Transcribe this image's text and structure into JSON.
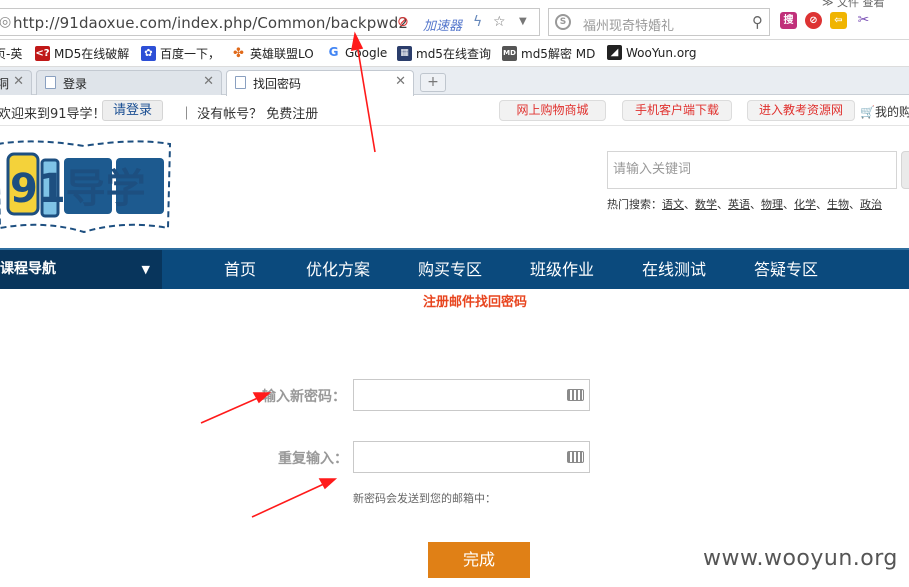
{
  "browser": {
    "url": "http://91daoxue.com/index.php/Common/backpwd2",
    "accelerator": "加速器",
    "search_placeholder": "福州现奇特婚礼",
    "top_menu": "≫   文件   查看"
  },
  "bookmarks": [
    {
      "label": "页-英"
    },
    {
      "label": "MD5在线破解"
    },
    {
      "label": "百度一下，"
    },
    {
      "label": "英雄联盟LO"
    },
    {
      "label": "Google"
    },
    {
      "label": "md5在线查询"
    },
    {
      "label": "md5解密 MD"
    },
    {
      "label": "WooYun.org"
    }
  ],
  "tabs": [
    {
      "label": "洞"
    },
    {
      "label": "登录"
    },
    {
      "label": "找回密码"
    }
  ],
  "site": {
    "welcome": "欢迎来到91导学！",
    "login_button": "请登录",
    "register_prefix": "｜ 没有帐号？",
    "register_link": "免费注册",
    "pills": [
      "网上购物商城",
      "手机客户端下载",
      "进入教考资源网"
    ],
    "cart": "我的购",
    "logo_text": "91导学",
    "search_placeholder": "请输入关键词",
    "hot_label": "热门搜索：",
    "hot_keywords": [
      "语文",
      "数学",
      "英语",
      "物理",
      "化学",
      "生物",
      "政治"
    ]
  },
  "nav": {
    "category": "课程导航",
    "items": [
      "首页",
      "优化方案",
      "购买专区",
      "班级作业",
      "在线测试",
      "答疑专区"
    ]
  },
  "form": {
    "title": "注册邮件找回密码",
    "new_password_label": "输入新密码：",
    "repeat_label": "重复输入：",
    "hint": "新密码会发送到您的邮箱中：",
    "submit": "完成"
  },
  "watermark": "www.wooyun.org",
  "colors": {
    "nav_bg": "#0b4a7d",
    "nav_category_bg": "#08355c",
    "submit_bg": "#e08016",
    "title_color": "#e8451f",
    "annotation_arrow": "#ff1a1a"
  }
}
